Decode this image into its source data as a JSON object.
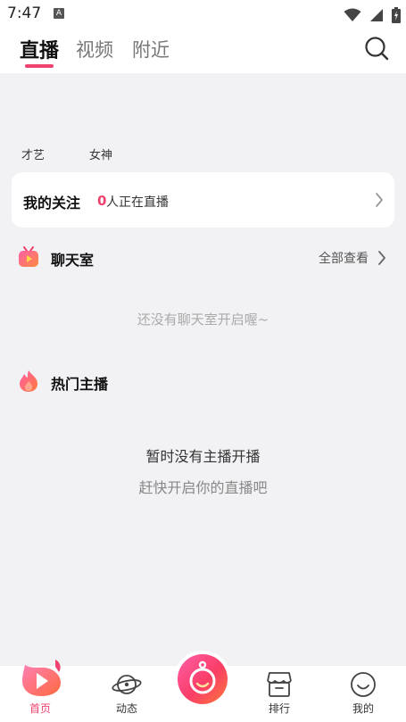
{
  "status_bar": {
    "time": "7:47",
    "notif_letter": "A"
  },
  "top_tabs": [
    {
      "label": "直播",
      "active": true
    },
    {
      "label": "视频",
      "active": false
    },
    {
      "label": "附近",
      "active": false
    }
  ],
  "categories": [
    "才艺",
    "女神"
  ],
  "follow_card": {
    "title": "我的关注",
    "count": "0",
    "text": "人正在直播"
  },
  "chat_room": {
    "title": "聊天室",
    "view_all": "全部查看",
    "empty_text": "还没有聊天室开启喔~"
  },
  "hot_hosts": {
    "title": "热门主播",
    "empty_line1": "暂时没有主播开播",
    "empty_line2": "赶快开启你的直播吧"
  },
  "bottom_nav": [
    {
      "label": "首页",
      "active": true
    },
    {
      "label": "动态",
      "active": false
    },
    {
      "label": "排行",
      "active": false
    },
    {
      "label": "我的",
      "active": false
    }
  ],
  "colors": {
    "accent": "#f0436f",
    "background": "#f2f2f5"
  }
}
